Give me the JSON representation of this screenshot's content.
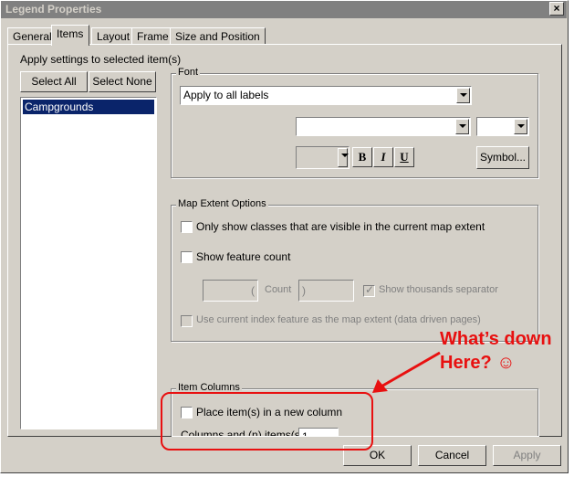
{
  "window": {
    "title": "Legend Properties",
    "close_glyph": "×"
  },
  "tabs": [
    {
      "label": "General"
    },
    {
      "label": "Items",
      "active": true
    },
    {
      "label": "Layout"
    },
    {
      "label": "Frame"
    },
    {
      "label": "Size and Position"
    }
  ],
  "items_panel": {
    "apply_label": "Apply settings to selected item(s)",
    "select_all": "Select All",
    "select_none": "Select None",
    "list_items": [
      {
        "label": "Campgrounds",
        "selected": true
      }
    ]
  },
  "font_group": {
    "legend": "Font",
    "apply_to": "Apply to all labels",
    "font_name": "",
    "font_size": "",
    "color": "",
    "bold": "B",
    "italic": "I",
    "underline": "U",
    "symbol_button": "Symbol..."
  },
  "map_extent": {
    "legend": "Map Extent Options",
    "visible_classes": "Only show classes that are visible in the current map extent",
    "show_count": "Show feature count",
    "count_prefix": "(",
    "count_label": "Count",
    "count_suffix": ")",
    "thousands_sep": "Show thousands separator",
    "index_feature": "Use current index feature as the map extent (data driven pages)"
  },
  "item_columns": {
    "legend": "Item Columns",
    "new_column": "Place item(s) in a new column",
    "columns_label": "Columns and (n) items(s):",
    "columns_value": "1"
  },
  "footer": {
    "ok": "OK",
    "cancel": "Cancel",
    "apply": "Apply"
  },
  "annotation": {
    "line1": "What’s down",
    "line2": "Here? ☺",
    "color": "#e81010"
  },
  "colors": {
    "dialog_face": "#d4d0c8",
    "title_bar": "#808080",
    "selection": "#0a246a"
  }
}
